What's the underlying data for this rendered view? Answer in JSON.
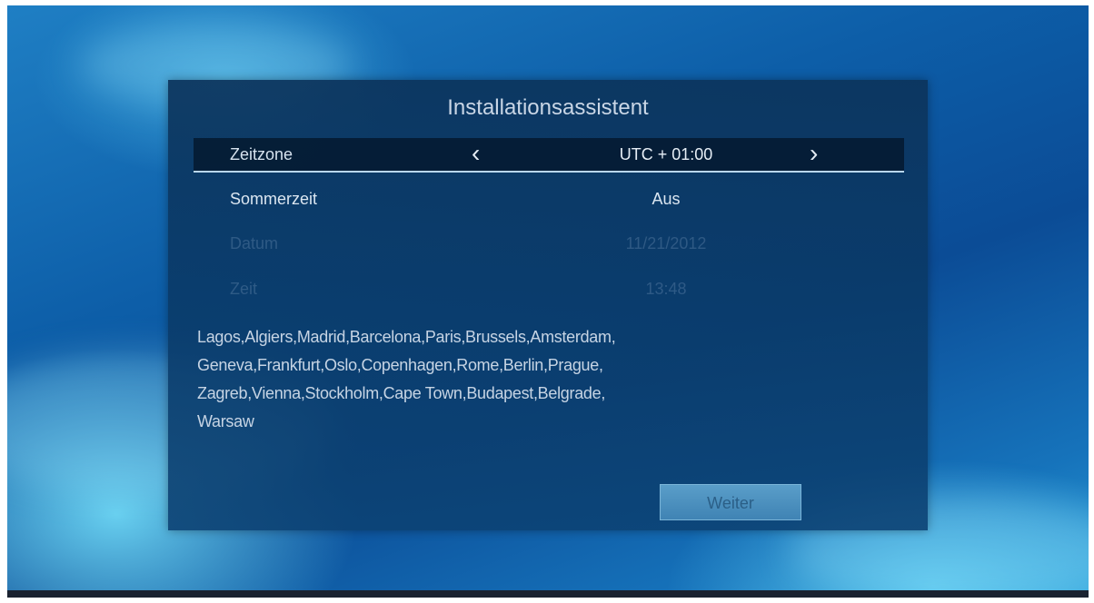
{
  "dialog": {
    "title": "Installationsassistent"
  },
  "settings": {
    "zeitzone": {
      "label": "Zeitzone",
      "value": "UTC + 01:00",
      "prev_arrow": "‹",
      "next_arrow": "›"
    },
    "sommerzeit": {
      "label": "Sommerzeit",
      "value": "Aus"
    },
    "datum": {
      "label": "Datum",
      "value": "11/21/2012"
    },
    "zeit": {
      "label": "Zeit",
      "value": "13:48"
    }
  },
  "cities": {
    "line1": "Lagos,Algiers,Madrid,Barcelona,Paris,Brussels,Amsterdam,",
    "line2": "Geneva,Frankfurt,Oslo,Copenhagen,Rome,Berlin,Prague,",
    "line3": "Zagreb,Vienna,Stockholm,Cape Town,Budapest,Belgrade,",
    "line4": "Warsaw"
  },
  "buttons": {
    "weiter": "Weiter"
  },
  "colors": {
    "dialog_background": "#0c3a68",
    "highlight_row": "#04162a",
    "button": "#4a8fbf"
  },
  "icons": {
    "prev": "chevron-left-icon",
    "next": "chevron-right-icon"
  }
}
